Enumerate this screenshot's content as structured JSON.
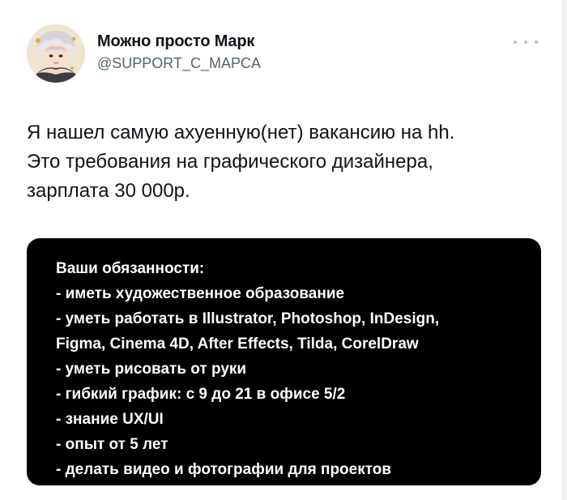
{
  "author": {
    "display_name": "Можно просто Марк",
    "handle": "@SUPPORT_C_MAPCA"
  },
  "tweet": {
    "text_lines": [
      "Я нашел самую ахуенную(нет) вакансию на hh.",
      "Это требования на графического дизайнера,",
      "зарплата 30 000р."
    ]
  },
  "media": {
    "lines": [
      "Ваши обязанности:",
      "- иметь художественное образование",
      "- уметь работать в Illustrator, Photoshop, InDesign,",
      "Figma, Cinema 4D, After Effects, Tilda, CorelDraw",
      "- уметь рисовать от руки",
      "- гибкий график: с 9 до 21 в офисе 5/2",
      "- знание UX/UI",
      "- опыт от 5 лет",
      "- делать видео и фотографии для проектов"
    ]
  },
  "icons": {
    "more": "more-horizontal-icon"
  },
  "colors": {
    "text_primary": "#0f1419",
    "text_secondary": "#536471",
    "media_background": "#000000",
    "media_text": "#ffffff"
  }
}
